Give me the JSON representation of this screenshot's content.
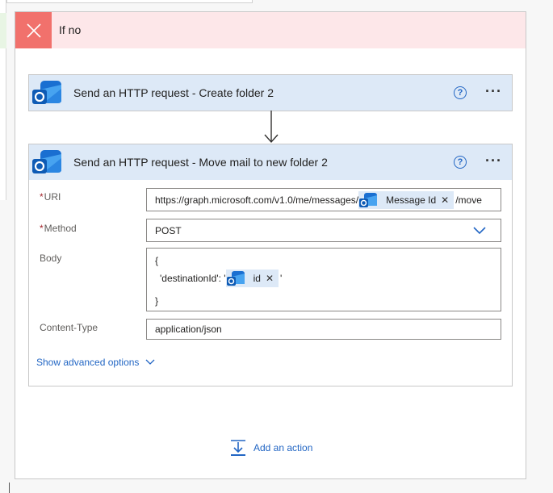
{
  "branch": {
    "title": "If no"
  },
  "card1": {
    "title": "Send an HTTP request - Create folder 2",
    "help": "?"
  },
  "card2": {
    "title": "Send an HTTP request - Move mail to new folder 2",
    "help": "?",
    "uri": {
      "label": "URI",
      "prefix": "https://graph.microsoft.com/v1.0/me/messages/",
      "token": "Message Id",
      "suffix": "/move"
    },
    "method": {
      "label": "Method",
      "value": "POST"
    },
    "body": {
      "label": "Body",
      "line1": "{",
      "line2_prefix": "'destinationId': '",
      "token": "id",
      "line2_suffix": "'",
      "line3": "}"
    },
    "content_type": {
      "label": "Content-Type",
      "value": "application/json"
    },
    "advanced": "Show advanced options"
  },
  "add_action": "Add an action",
  "icons": {
    "close": "close-icon",
    "help": "help-circle-icon",
    "more": "more-icon",
    "outlook": "outlook-icon",
    "chevron": "chevron-down-icon",
    "add": "add-action-icon"
  },
  "colors": {
    "branch_header": "#fde7e9",
    "branch_x": "#f1716c",
    "card_header": "#dde9f7",
    "link": "#2266c4"
  }
}
